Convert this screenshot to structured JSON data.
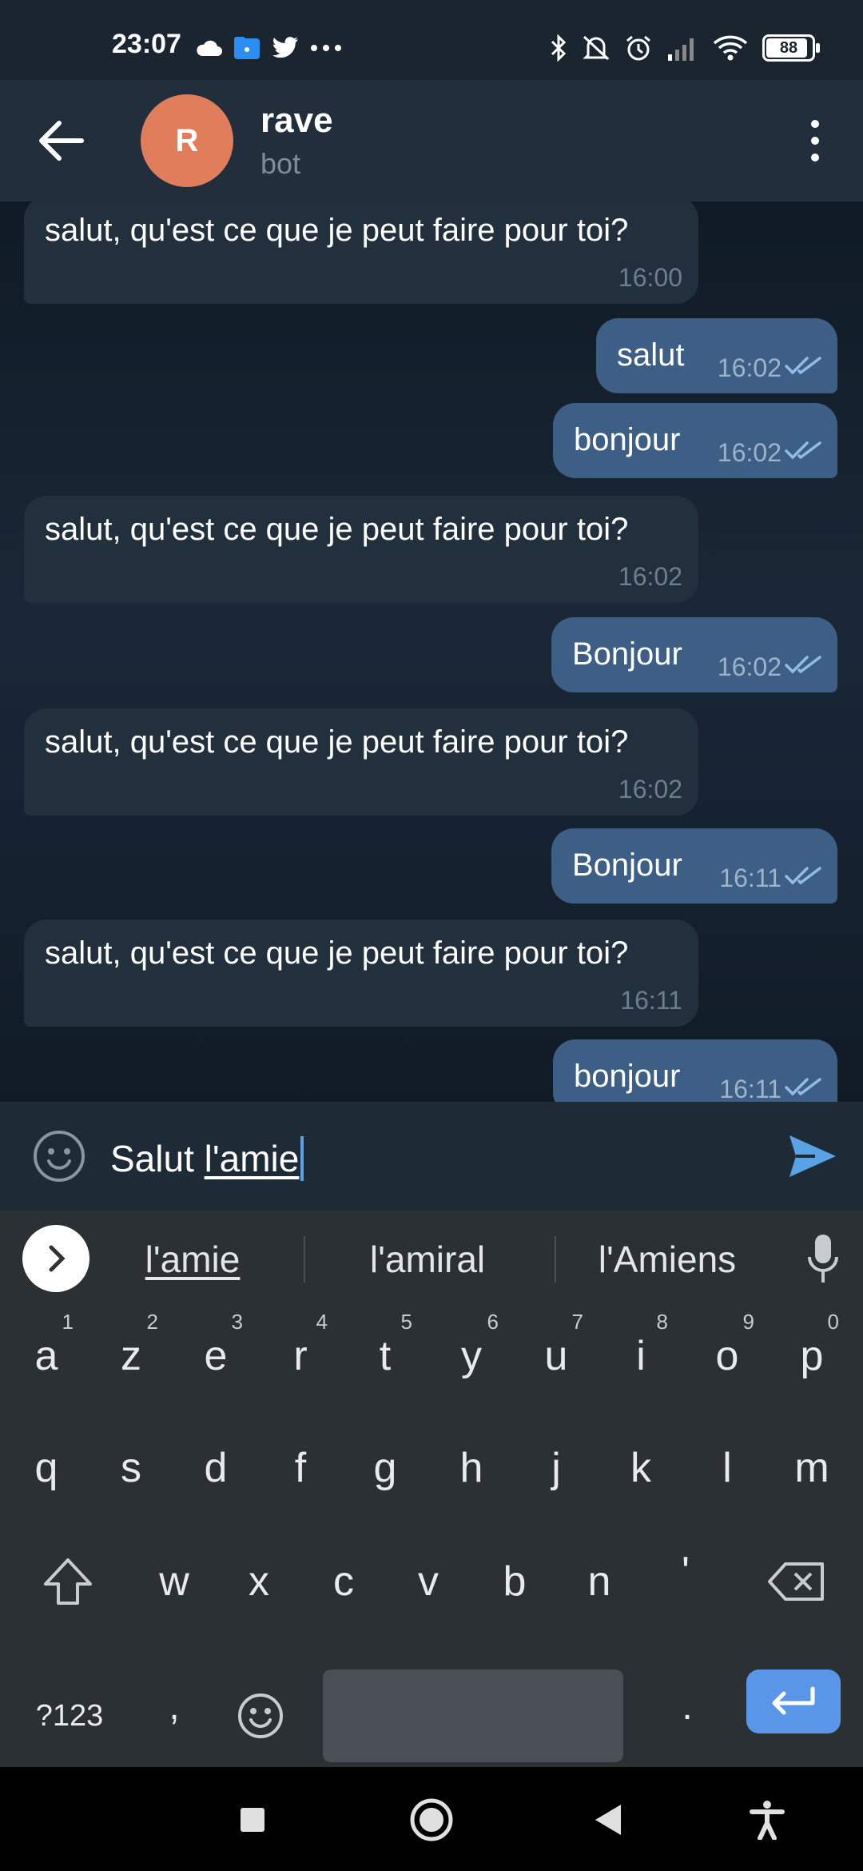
{
  "status_bar": {
    "time": "23:07",
    "left_icons": [
      "cloud-icon",
      "folder-icon",
      "twitter-icon",
      "more-dots-icon"
    ],
    "right_icons": [
      "bluetooth-icon",
      "mute-icon",
      "alarm-icon",
      "signal-icon",
      "wifi-icon"
    ],
    "battery": "88"
  },
  "header": {
    "avatar_letter": "R",
    "avatar_color": "#e07e5c",
    "title": "rave",
    "subtitle": "bot"
  },
  "messages": [
    {
      "dir": "in",
      "text": "salut, qu'est ce que je peut faire pour toi?",
      "time": "16:00"
    },
    {
      "dir": "out",
      "text": "salut",
      "time": "16:02"
    },
    {
      "dir": "out",
      "text": "bonjour",
      "time": "16:02"
    },
    {
      "dir": "in",
      "text": "salut, qu'est ce que je peut faire pour toi?",
      "time": "16:02"
    },
    {
      "dir": "out",
      "text": "Bonjour",
      "time": "16:02"
    },
    {
      "dir": "in",
      "text": "salut, qu'est ce que je peut faire pour toi?",
      "time": "16:02"
    },
    {
      "dir": "out",
      "text": "Bonjour",
      "time": "16:11"
    },
    {
      "dir": "in",
      "text": "salut, qu'est ce que je peut faire pour toi?",
      "time": "16:11"
    },
    {
      "dir": "out",
      "text": "bonjour",
      "time": "16:11"
    }
  ],
  "input": {
    "text_plain": "Salut ",
    "text_underlined": "l'amie"
  },
  "suggestions": [
    "l'amie",
    "l'amiral",
    "l'Amiens"
  ],
  "keyboard": {
    "row1": [
      {
        "k": "a",
        "h": "1"
      },
      {
        "k": "z",
        "h": "2"
      },
      {
        "k": "e",
        "h": "3"
      },
      {
        "k": "r",
        "h": "4"
      },
      {
        "k": "t",
        "h": "5"
      },
      {
        "k": "y",
        "h": "6"
      },
      {
        "k": "u",
        "h": "7"
      },
      {
        "k": "i",
        "h": "8"
      },
      {
        "k": "o",
        "h": "9"
      },
      {
        "k": "p",
        "h": "0"
      }
    ],
    "row2": [
      "q",
      "s",
      "d",
      "f",
      "g",
      "h",
      "j",
      "k",
      "l",
      "m"
    ],
    "row3": [
      "w",
      "x",
      "c",
      "v",
      "b",
      "n",
      "'"
    ],
    "symbols_label": "?123",
    "comma": ",",
    "period": "."
  },
  "colors": {
    "accent": "#5aa2e6",
    "outgoing_bubble": "#3e5f85",
    "incoming_bubble": "#222f3d",
    "enter_key": "#5a96e8"
  }
}
